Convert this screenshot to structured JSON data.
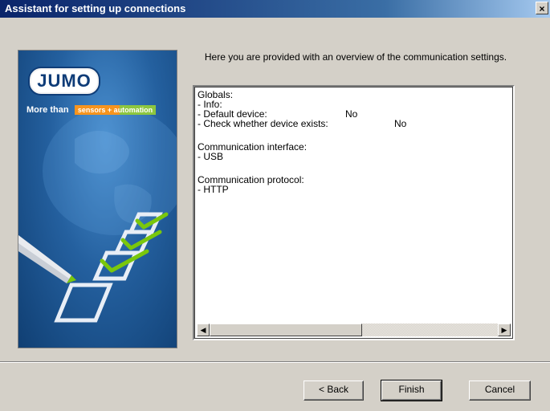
{
  "window": {
    "title": "Assistant for setting up connections",
    "close_label": "×"
  },
  "banner": {
    "logo_text": "JUMO",
    "slogan_prefix": "More than",
    "slogan_tag": "sensors + automation"
  },
  "intro_text": "Here you are provided with an overview of the communication settings.",
  "settings": {
    "globals_header": "Globals:",
    "info_label": "- Info:",
    "default_device_label": "- Default device:",
    "default_device_value": "No",
    "check_device_label": "- Check whether device exists:",
    "check_device_value": "No",
    "interface_header": "Communication interface:",
    "interface_value": "- USB",
    "protocol_header": "Communication protocol:",
    "protocol_value": "- HTTP"
  },
  "scrollbar": {
    "left_arrow": "◀",
    "right_arrow": "▶",
    "position": 0.0
  },
  "buttons": {
    "back_label": "< Back",
    "finish_label": "Finish",
    "cancel_label": "Cancel"
  },
  "colors": {
    "title_bar_start": "#0a246a",
    "dialog_background": "#d4d0c8",
    "brand_orange": "#f7941d",
    "brand_green": "#8dc63f",
    "check_green": "#7ac70c"
  }
}
